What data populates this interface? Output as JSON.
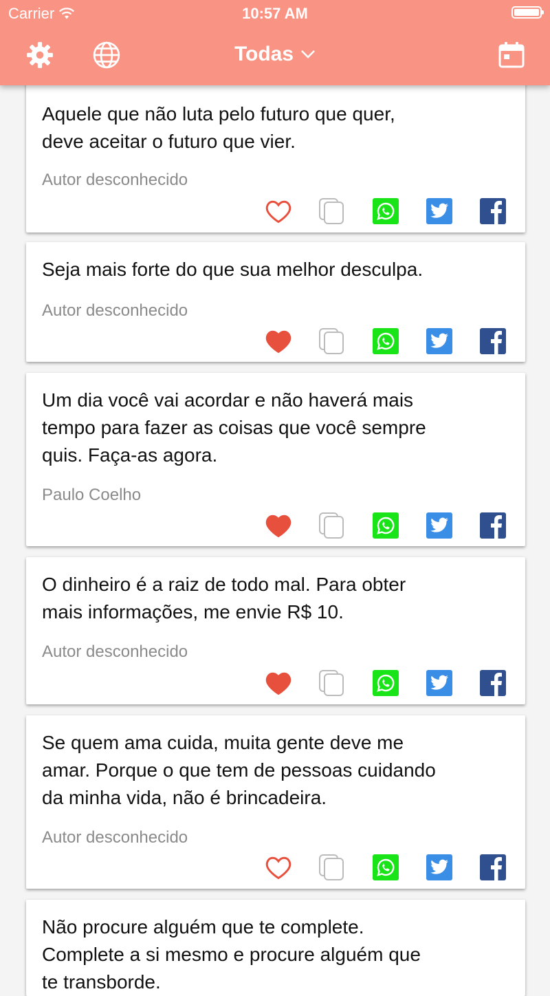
{
  "status_bar": {
    "carrier": "Carrier",
    "time": "10:57 AM"
  },
  "nav": {
    "title": "Todas",
    "left_icons": [
      "gear-icon",
      "globe-icon"
    ],
    "right_icons": [
      "calendar-icon"
    ]
  },
  "colors": {
    "header": "#f99484",
    "heart": "#e8503e",
    "whatsapp": "#18e418",
    "twitter": "#3a8ee6",
    "facebook": "#2f4f8f"
  },
  "quotes": [
    {
      "lines": [
        "Aquele que não luta pelo futuro que quer,",
        "deve aceitar o futuro que vier."
      ],
      "author": "Autor desconhecido",
      "favorited": false
    },
    {
      "lines": [
        "Seja mais forte do que sua melhor desculpa."
      ],
      "author": "Autor desconhecido",
      "favorited": true
    },
    {
      "lines": [
        "Um dia você vai acordar e não haverá mais",
        "tempo para fazer as coisas que você sempre",
        "quis. Faça-as agora."
      ],
      "author": "Paulo Coelho",
      "favorited": true
    },
    {
      "lines": [
        "O dinheiro é a raiz de todo mal. Para obter",
        "mais informações, me envie R$ 10."
      ],
      "author": "Autor desconhecido",
      "favorited": true
    },
    {
      "lines": [
        "Se quem ama cuida, muita gente deve me",
        "amar. Porque o que tem de pessoas cuidando",
        "da minha vida, não é brincadeira."
      ],
      "author": "Autor desconhecido",
      "favorited": false
    },
    {
      "lines": [
        "Não procure alguém que te complete.",
        "Complete a si mesmo e procure alguém que",
        "te transborde."
      ],
      "author": "",
      "favorited": false
    }
  ]
}
